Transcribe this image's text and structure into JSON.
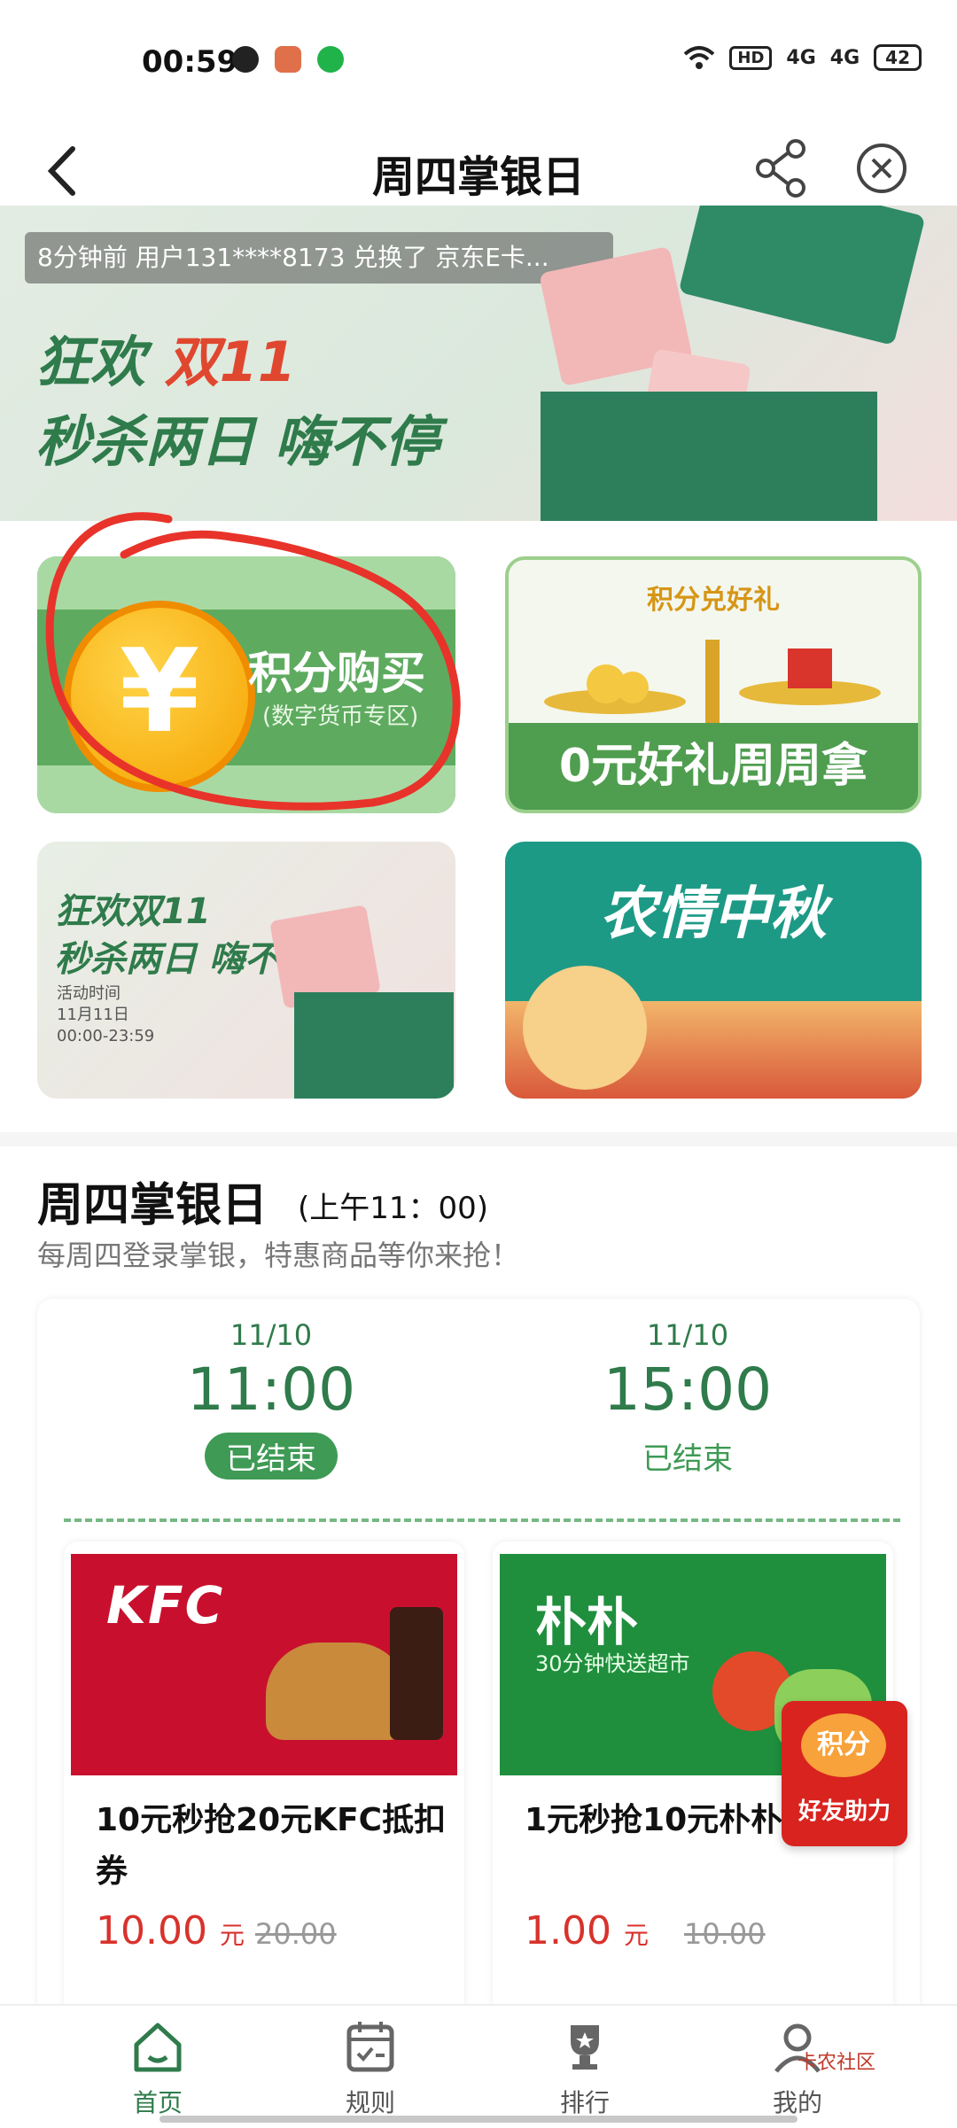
{
  "status": {
    "time": "00:59",
    "network1": "HD",
    "network2": "4G",
    "network3": "4G",
    "battery": "42"
  },
  "header": {
    "title": "周四掌银日"
  },
  "hero": {
    "ticker": "8分钟前 用户131****8173 兑换了 京东E卡...",
    "line1_a": "狂欢",
    "line1_b": "双11",
    "line2": "秒杀两日 嗨不停"
  },
  "cards": {
    "points_buy_title": "积分购买",
    "points_buy_sub": "(数字货币专区)",
    "points_gift_top": "积分兑好礼",
    "points_gift_bottom": "0元好礼周周拿",
    "promo_l1": "狂欢双11",
    "promo_l2": "秒杀两日 嗨不停",
    "promo_small": "活动时间\n11月11日\n00:00-23:59",
    "autumn_title": "农情中秋"
  },
  "section": {
    "title": "周四掌银日",
    "time": "(上午11：00)",
    "desc": "每周四登录掌银，特惠商品等你来抢！"
  },
  "slots": [
    {
      "date": "11/10",
      "time": "11:00",
      "status": "已结束"
    },
    {
      "date": "11/10",
      "time": "15:00",
      "status": "已结束"
    }
  ],
  "products": [
    {
      "brand": "KFC",
      "name": "10元秒抢20元KFC抵扣券",
      "price": "10.00",
      "unit": "元",
      "old_price": "20.00"
    },
    {
      "brand": "朴朴",
      "brand_sub": "30分钟快送超市",
      "name": "1元秒抢10元朴朴券",
      "price": "1.00",
      "unit": "元",
      "old_price": "10.00"
    }
  ],
  "help_badge": {
    "top": "积分",
    "label": "好友助力"
  },
  "nav": [
    {
      "label": "首页"
    },
    {
      "label": "规则"
    },
    {
      "label": "排行"
    },
    {
      "label": "我的"
    }
  ],
  "watermark": "卡农社区",
  "colors": {
    "brand_green": "#2f7b4b",
    "accent_red": "#d8322c"
  }
}
